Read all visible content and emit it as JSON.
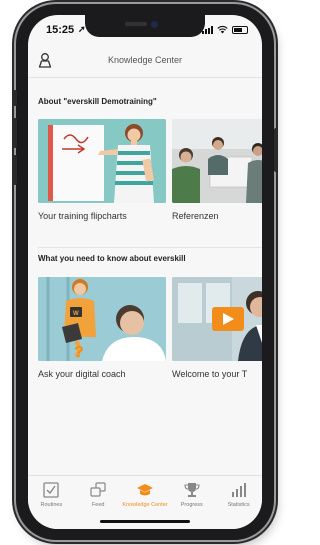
{
  "status_bar": {
    "time": "15:25"
  },
  "header": {
    "title": "Knowledge Center"
  },
  "sections": [
    {
      "title": "About \"everskill Demotraining\"",
      "cards": [
        {
          "label": "Your training flipcharts"
        },
        {
          "label": "Referenzen"
        }
      ]
    },
    {
      "title": "What you need to know about everskill",
      "cards": [
        {
          "label": "Ask your digital coach"
        },
        {
          "label": "Welcome to your T"
        }
      ]
    }
  ],
  "tabbar": {
    "items": [
      {
        "label": "Routines",
        "icon": "checkbox-icon"
      },
      {
        "label": "Feed",
        "icon": "feed-icon"
      },
      {
        "label": "Knowledge Center",
        "icon": "knowledge-center-icon",
        "active": true
      },
      {
        "label": "Progress",
        "icon": "trophy-icon"
      },
      {
        "label": "Statistics",
        "icon": "bar-chart-icon"
      }
    ]
  },
  "colors": {
    "accent": "#f28c1a",
    "flipchart_bg": "#86c9c4",
    "coach_bg": "#8fc3cf"
  }
}
